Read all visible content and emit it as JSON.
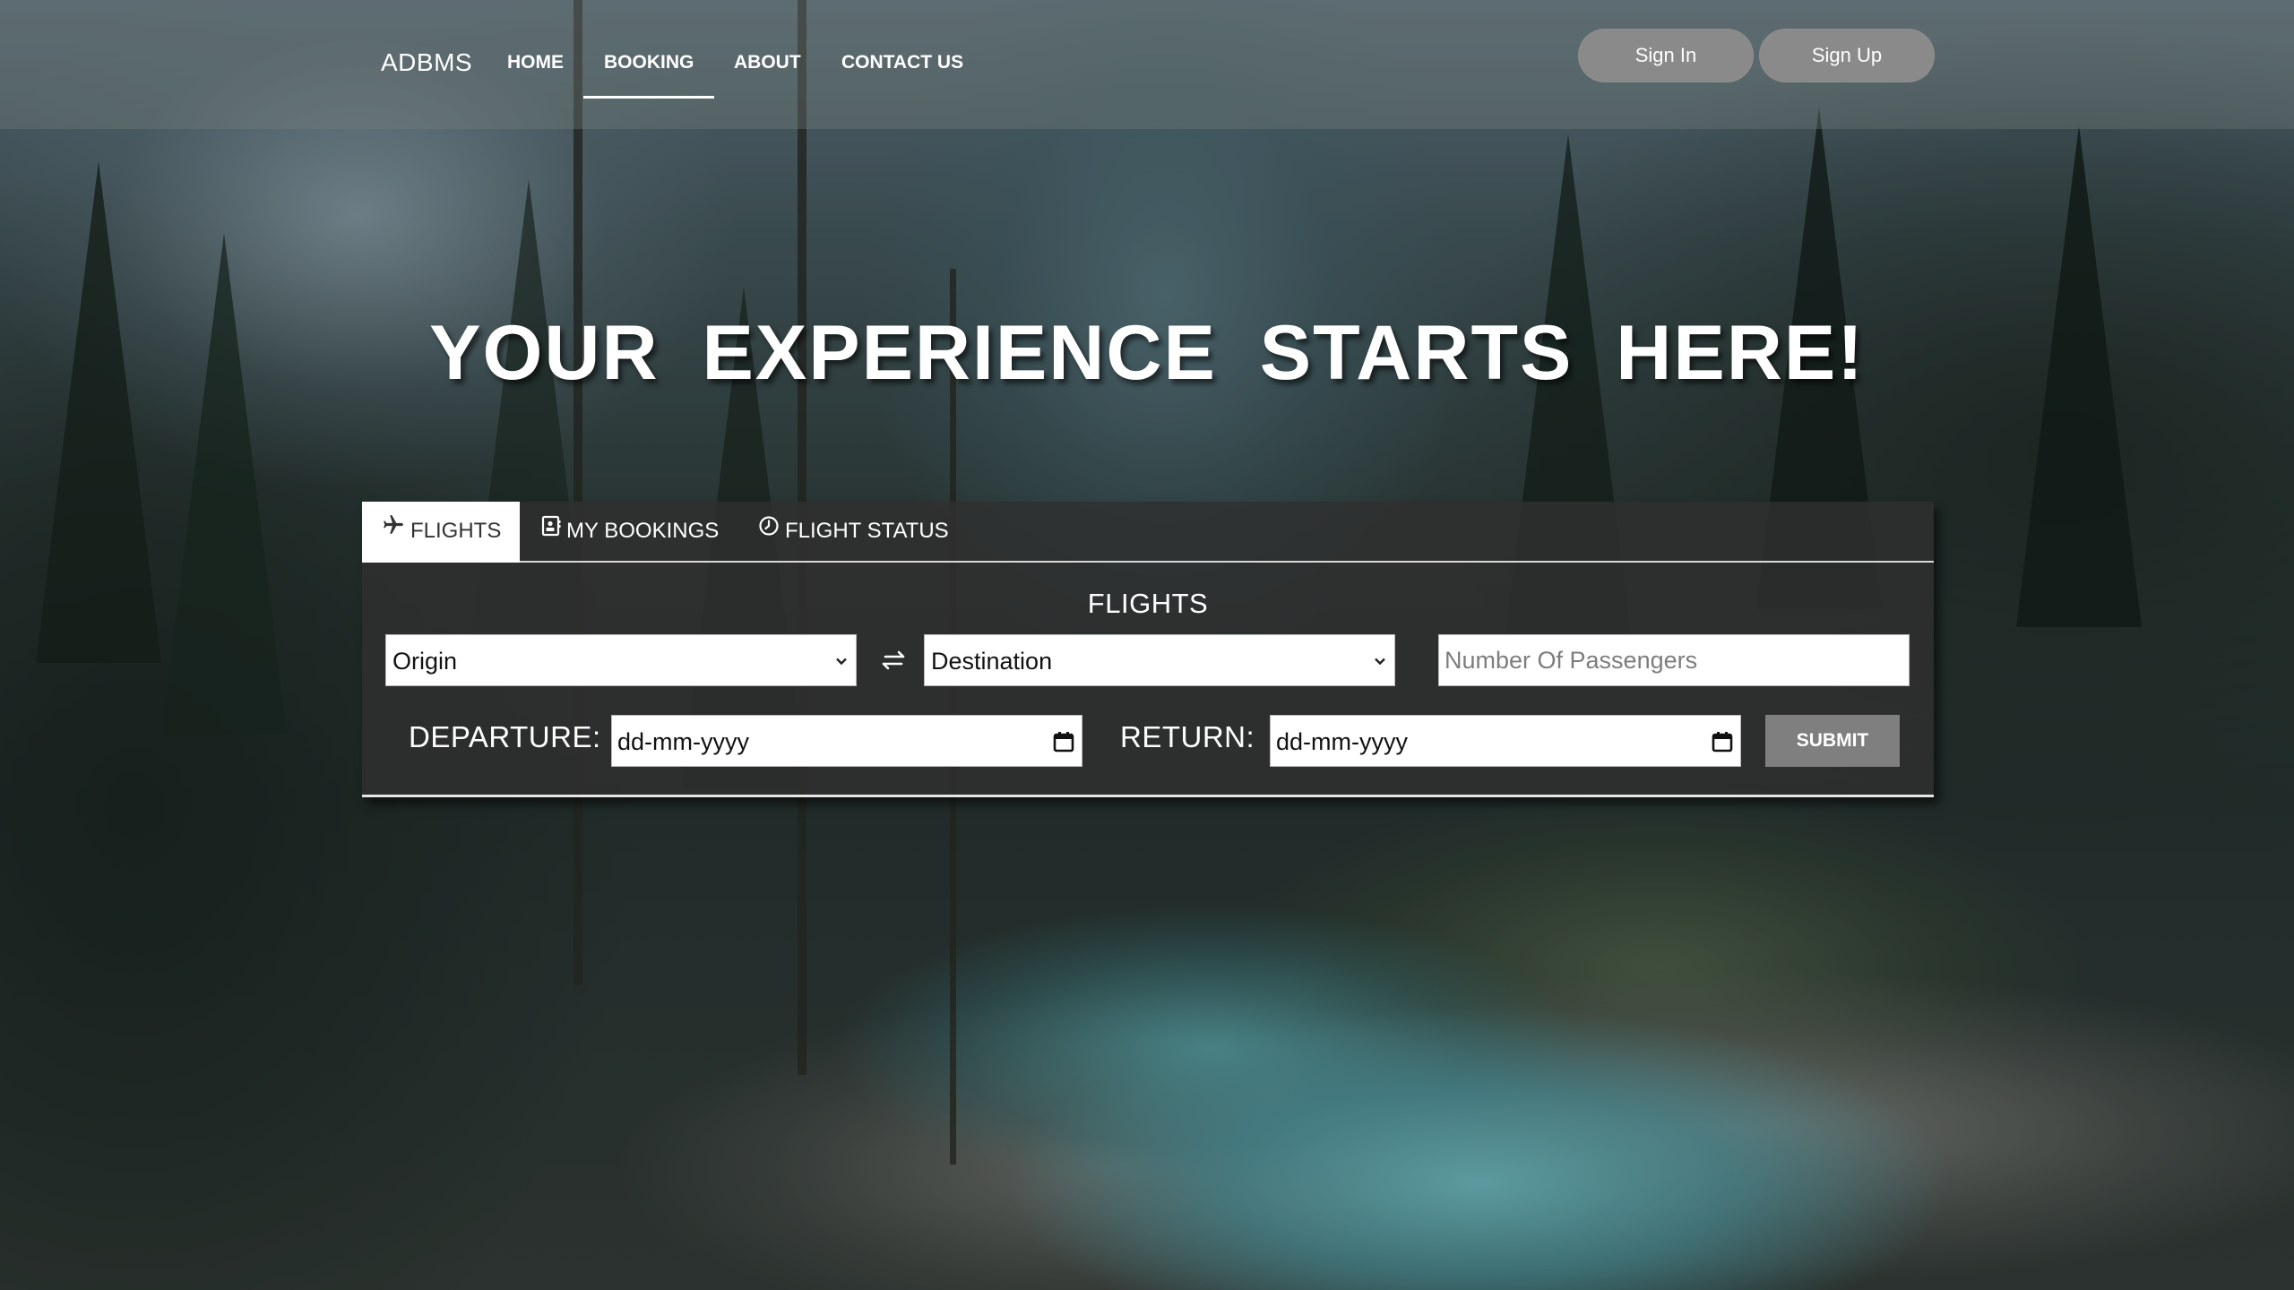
{
  "header": {
    "brand": "ADBMS",
    "nav": [
      {
        "label": "HOME"
      },
      {
        "label": "BOOKING",
        "active": true
      },
      {
        "label": "ABOUT"
      },
      {
        "label": "CONTACT US"
      }
    ],
    "sign_in": "Sign In",
    "sign_up": "Sign Up"
  },
  "hero": {
    "title": "YOUR EXPERIENCE STARTS HERE!"
  },
  "booking": {
    "tabs": [
      {
        "label": "FLIGHTS",
        "icon": "plane-icon",
        "active": true
      },
      {
        "label": "MY BOOKINGS",
        "icon": "booking-card-icon"
      },
      {
        "label": "FLIGHT STATUS",
        "icon": "clock-icon"
      }
    ],
    "heading": "FLIGHTS",
    "origin": {
      "value": "Origin"
    },
    "destination": {
      "value": "Destination"
    },
    "swap_icon": "swap-arrows-icon",
    "passengers": {
      "placeholder": "Number Of Passengers",
      "value": ""
    },
    "departure": {
      "label": "DEPARTURE:",
      "value": "dd-mm-yyyy"
    },
    "return": {
      "label": "RETURN:",
      "value": "dd-mm-yyyy"
    },
    "submit_label": "SUBMIT"
  },
  "colors": {
    "panel_bg": "#303030",
    "submit_bg": "#7f7f7f",
    "auth_button_bg": "#8a8a8a",
    "text": "#ffffff"
  }
}
